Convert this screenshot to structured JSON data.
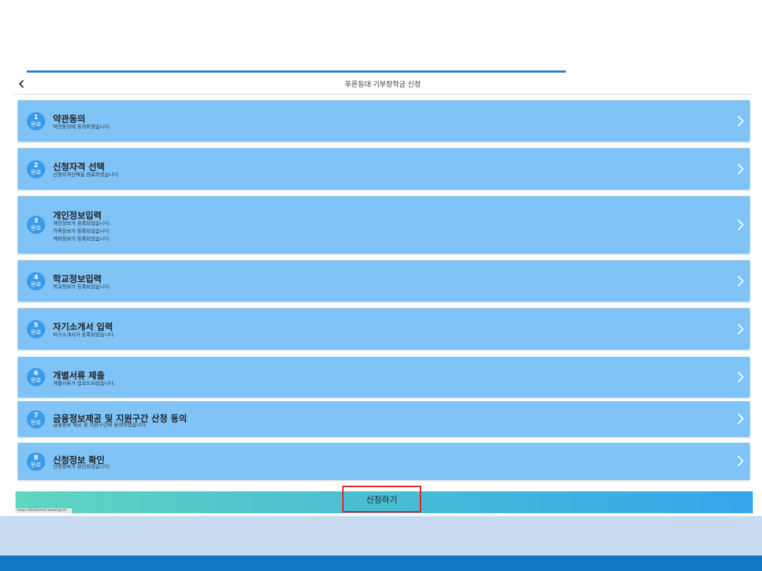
{
  "header": {
    "title": "푸른등대 기부장학금 신청"
  },
  "steps": [
    {
      "num": "1",
      "status": "완료",
      "title": "약관동의",
      "desc": [
        "약관동의에 동의하였습니다."
      ]
    },
    {
      "num": "2",
      "status": "완료",
      "title": "신청자격 선택",
      "desc": [
        "신청자격선택을 완료하였습니다."
      ]
    },
    {
      "num": "3",
      "status": "완료",
      "title": "개인정보입력",
      "desc": [
        "개인정보가 등록되었습니다.",
        "가족정보가 등록되었습니다.",
        "계좌정보가 등록되었습니다."
      ]
    },
    {
      "num": "4",
      "status": "완료",
      "title": "학교정보입력",
      "desc": [
        "학교정보가 등록되었습니다."
      ]
    },
    {
      "num": "5",
      "status": "완료",
      "title": "자기소개서 입력",
      "desc": [
        "자기소개서가 등록되었습니다."
      ]
    },
    {
      "num": "6",
      "status": "완료",
      "title": "개별서류 제출",
      "desc": [
        "개별서류가 업로드되었습니다."
      ]
    },
    {
      "num": "7",
      "status": "완료",
      "title": "금융정보제공 및 지원구간 산정 동의",
      "desc": [
        "금융정보 제공 및 지원구간에 동의하였습니다."
      ]
    },
    {
      "num": "8",
      "status": "완료",
      "title": "신청정보 확인",
      "desc": [
        "신청정보가 확인되었습니다."
      ]
    }
  ],
  "submit": {
    "label": "신청하기"
  },
  "url_tag": "https://bluetomb.kosaf.go.kr",
  "colors": {
    "card": "#80c4f7",
    "badge": "#3a9bea",
    "accent": "#1f7ad1",
    "highlight": "#e11d1d"
  },
  "icons": {
    "back": "chevron-left-icon",
    "step_arrow": "chevron-right-icon"
  }
}
